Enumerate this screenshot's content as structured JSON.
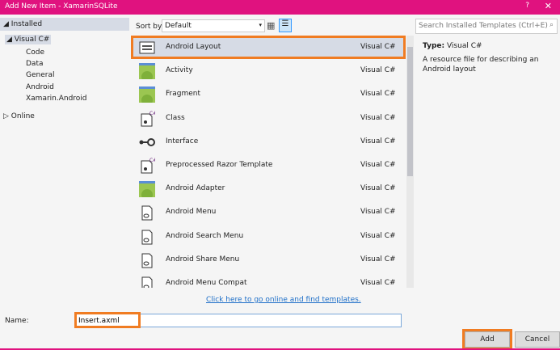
{
  "window": {
    "title": "Add New Item - XamarinSQLite",
    "help": "?",
    "close": "✕"
  },
  "tree": {
    "installed": "Installed",
    "visual_csharp": "Visual C#",
    "children": [
      "Code",
      "Data",
      "General",
      "Android",
      "Xamarin.Android"
    ],
    "online": "Online"
  },
  "sort": {
    "label": "Sort by:",
    "value": "Default"
  },
  "templates": [
    {
      "name": "Android Layout",
      "lang": "Visual C#",
      "icon": "layout"
    },
    {
      "name": "Activity",
      "lang": "Visual C#",
      "icon": "android"
    },
    {
      "name": "Fragment",
      "lang": "Visual C#",
      "icon": "android"
    },
    {
      "name": "Class",
      "lang": "Visual C#",
      "icon": "class"
    },
    {
      "name": "Interface",
      "lang": "Visual C#",
      "icon": "interface"
    },
    {
      "name": "Preprocessed Razor Template",
      "lang": "Visual C#",
      "icon": "class"
    },
    {
      "name": "Android Adapter",
      "lang": "Visual C#",
      "icon": "android"
    },
    {
      "name": "Android Menu",
      "lang": "Visual C#",
      "icon": "file"
    },
    {
      "name": "Android Search Menu",
      "lang": "Visual C#",
      "icon": "file"
    },
    {
      "name": "Android Share Menu",
      "lang": "Visual C#",
      "icon": "file"
    },
    {
      "name": "Android Menu Compat",
      "lang": "Visual C#",
      "icon": "file"
    }
  ],
  "search": {
    "placeholder": "Search Installed Templates (Ctrl+E)"
  },
  "details": {
    "type_label": "Type:",
    "type_value": "Visual C#",
    "description": "A resource file for describing an Android layout"
  },
  "link": "Click here to go online and find templates.",
  "name": {
    "label": "Name:",
    "value": "Insert.axml"
  },
  "buttons": {
    "add": "Add",
    "cancel": "Cancel"
  },
  "colors": {
    "title": "#e0127f",
    "highlight": "#f07c22"
  }
}
